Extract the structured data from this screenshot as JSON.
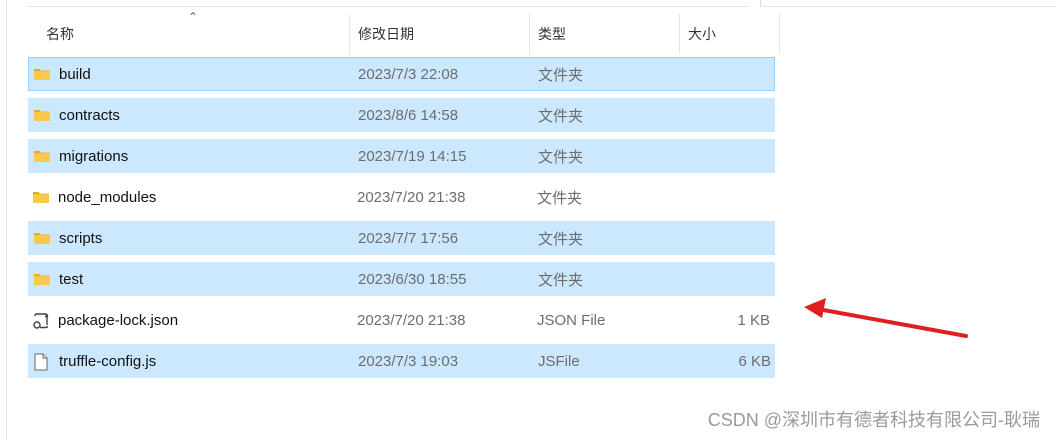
{
  "columns": {
    "name": "名称",
    "date": "修改日期",
    "type": "类型",
    "size": "大小"
  },
  "rows": [
    {
      "name": "build",
      "date": "2023/7/3 22:08",
      "type": "文件夹",
      "size": "",
      "icon": "folder-icon",
      "selected": true
    },
    {
      "name": "contracts",
      "date": "2023/8/6 14:58",
      "type": "文件夹",
      "size": "",
      "icon": "folder-icon",
      "selected": true
    },
    {
      "name": "migrations",
      "date": "2023/7/19 14:15",
      "type": "文件夹",
      "size": "",
      "icon": "folder-icon",
      "selected": true
    },
    {
      "name": "node_modules",
      "date": "2023/7/20 21:38",
      "type": "文件夹",
      "size": "",
      "icon": "folder-icon",
      "selected": false
    },
    {
      "name": "scripts",
      "date": "2023/7/7 17:56",
      "type": "文件夹",
      "size": "",
      "icon": "folder-icon",
      "selected": true
    },
    {
      "name": "test",
      "date": "2023/6/30 18:55",
      "type": "文件夹",
      "size": "",
      "icon": "folder-icon",
      "selected": true
    },
    {
      "name": "package-lock.json",
      "date": "2023/7/20 21:38",
      "type": "JSON File",
      "size": "1 KB",
      "icon": "json-file-icon",
      "selected": false
    },
    {
      "name": "truffle-config.js",
      "date": "2023/7/3 19:03",
      "type": "JSFile",
      "size": "6 KB",
      "icon": "js-file-icon",
      "selected": true
    }
  ],
  "annotation": {
    "arrow_color": "#e02020"
  },
  "watermark": "CSDN @深圳市有德者科技有限公司-耿瑞",
  "colors": {
    "selection_bg": "#cce8ff",
    "selection_border": "#99d1ff",
    "folder": "#f8c94a"
  }
}
